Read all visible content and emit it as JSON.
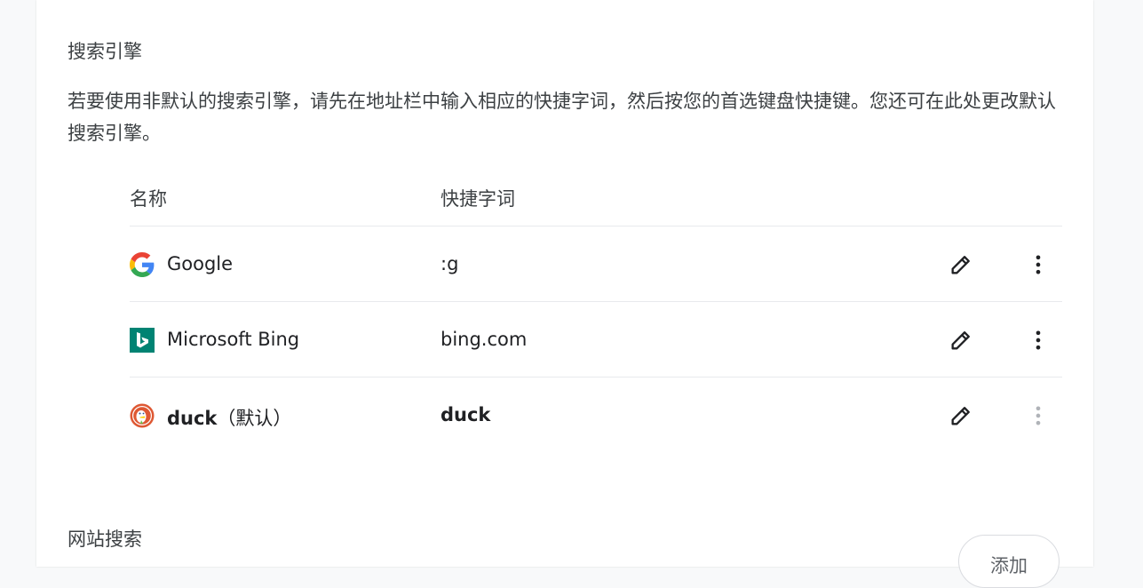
{
  "search_engines_section": {
    "title": "搜索引擎",
    "description": "若要使用非默认的搜索引擎，请先在地址栏中输入相应的快捷字词，然后按您的首选键盘快捷键。您还可在此处更改默认搜索引擎。",
    "columns": {
      "name": "名称",
      "keyword": "快捷字词"
    },
    "engines": [
      {
        "name": "Google",
        "suffix": "",
        "keyword": ":g",
        "icon": "google-icon",
        "is_default": false
      },
      {
        "name": "Microsoft Bing",
        "suffix": "",
        "keyword": "bing.com",
        "icon": "bing-icon",
        "is_default": false
      },
      {
        "name": "duck",
        "suffix": "（默认）",
        "keyword": "duck",
        "icon": "duckduckgo-icon",
        "is_default": true
      }
    ]
  },
  "site_search_section": {
    "title": "网站搜索",
    "add_button_label": "添加"
  },
  "colors": {
    "divider": "#e8eaed",
    "text_primary": "#202124",
    "text_secondary": "#3c4043",
    "bing_teal": "#008373",
    "duck_orange": "#de5833",
    "disabled_icon": "#b0b3b8"
  }
}
